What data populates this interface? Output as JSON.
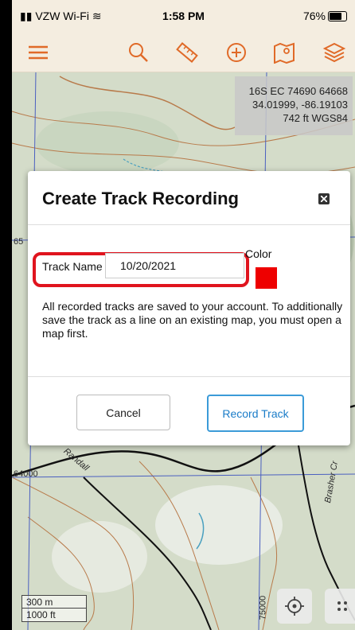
{
  "status": {
    "carrier": "VZW Wi-Fi",
    "time": "1:58 PM",
    "battery": "76%"
  },
  "toolbar": {
    "icons": [
      "menu-icon",
      "search-icon",
      "ruler-icon",
      "add-icon",
      "map-marker-icon",
      "layers-icon"
    ],
    "accent": "#e06a28"
  },
  "coords": {
    "utm": "16S EC 74690 64668",
    "latlon": "34.01999, -86.19103",
    "elev": "742 ft   WGS84"
  },
  "map_labels": {
    "grid_left_top": "65",
    "grid_left_bottom": "64000",
    "road_randall": "Randall",
    "road_brasher": "Brasher Cr",
    "grid_bottom": "75000"
  },
  "dialog": {
    "title": "Create Track Recording",
    "track_name_label": "Track Name",
    "track_name_value": "10/20/2021",
    "color_label": "Color",
    "color_value": "#ee0000",
    "message": "All recorded tracks are saved to your account. To additionally save the track as a line on an existing map, you must open a map first.",
    "cancel_label": "Cancel",
    "record_label": "Record Track"
  },
  "scale": {
    "metric": "300 m",
    "imperial": "1000 ft"
  }
}
